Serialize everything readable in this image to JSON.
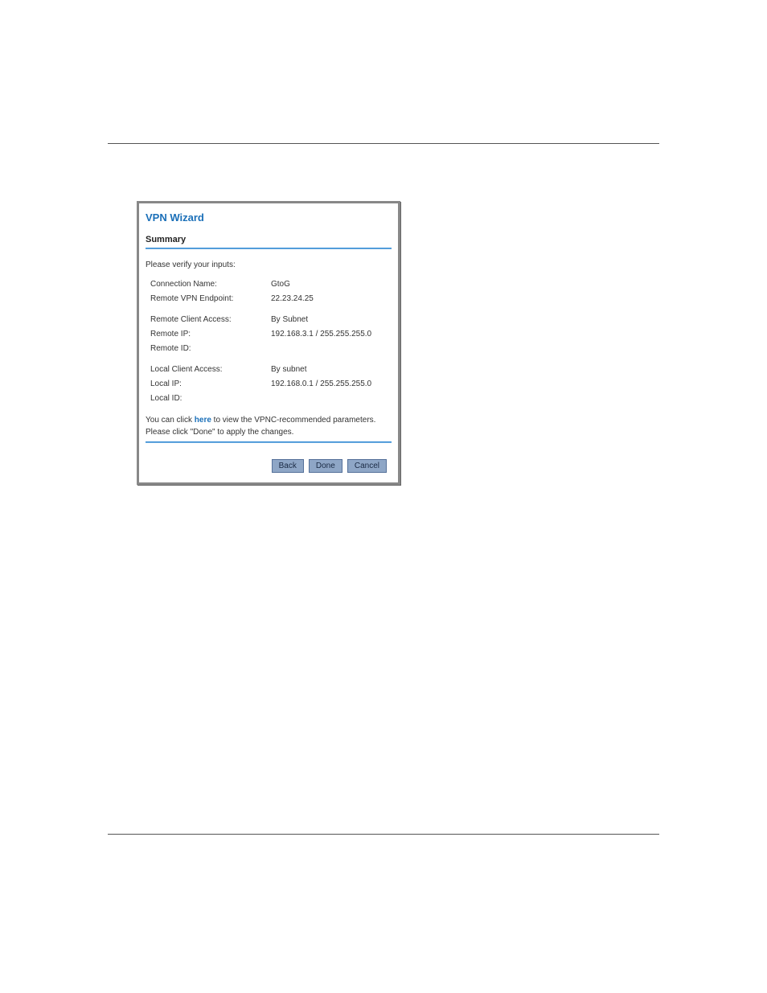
{
  "wizard": {
    "title": "VPN Wizard",
    "section": "Summary",
    "prompt": "Please verify your inputs:",
    "rows": [
      {
        "label": "Connection Name:",
        "value": "GtoG"
      },
      {
        "label": "Remote VPN Endpoint:",
        "value": "22.23.24.25"
      }
    ],
    "rows2": [
      {
        "label": "Remote Client Access:",
        "value": "By Subnet"
      },
      {
        "label": "Remote IP:",
        "value": "192.168.3.1 / 255.255.255.0"
      },
      {
        "label": "Remote ID:",
        "value": ""
      }
    ],
    "rows3": [
      {
        "label": "Local Client Access:",
        "value": "By subnet"
      },
      {
        "label": "Local IP:",
        "value": "192.168.0.1 / 255.255.255.0"
      },
      {
        "label": "Local ID:",
        "value": ""
      }
    ],
    "note_pre": "You can click ",
    "note_link": "here",
    "note_post": " to view the VPNC-recommended parameters.",
    "apply": "Please click \"Done\" to apply the changes.",
    "buttons": {
      "back": "Back",
      "done": "Done",
      "cancel": "Cancel"
    }
  }
}
